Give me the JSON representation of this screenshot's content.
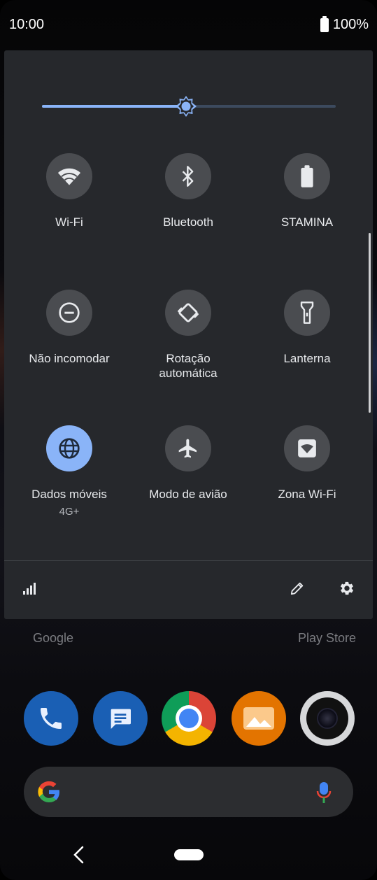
{
  "status_bar": {
    "time": "10:00",
    "battery_percent": "100%"
  },
  "brightness": {
    "level": 0.49
  },
  "tiles": [
    {
      "label": "Wi-Fi",
      "icon": "wifi-icon",
      "active": false
    },
    {
      "label": "Bluetooth",
      "icon": "bluetooth-icon",
      "active": false
    },
    {
      "label": "STAMINA",
      "icon": "battery-icon",
      "active": false
    },
    {
      "label": "Não incomodar",
      "icon": "do-not-disturb-icon",
      "active": false
    },
    {
      "label": "Rotação automática",
      "icon": "auto-rotate-icon",
      "active": false
    },
    {
      "label": "Lanterna",
      "icon": "flashlight-icon",
      "active": false
    },
    {
      "label": "Dados móveis",
      "sublabel": "4G+",
      "icon": "globe-icon",
      "active": true
    },
    {
      "label": "Modo de avião",
      "icon": "airplane-icon",
      "active": false
    },
    {
      "label": "Zona Wi-Fi",
      "icon": "hotspot-icon",
      "active": false
    }
  ],
  "footer": {
    "signal_icon": "signal-icon",
    "edit_icon": "pencil-icon",
    "settings_icon": "gear-icon"
  },
  "home": {
    "labels": [
      "Google",
      "Play Store"
    ],
    "dock": [
      "phone-icon",
      "messages-icon",
      "chrome-icon",
      "gallery-icon",
      "camera-icon"
    ],
    "search": {
      "logo": "google-g-icon",
      "mic": "mic-icon"
    }
  },
  "colors": {
    "accent": "#8ab4f8",
    "panel": "#26282c",
    "tile": "#4a4c50"
  }
}
